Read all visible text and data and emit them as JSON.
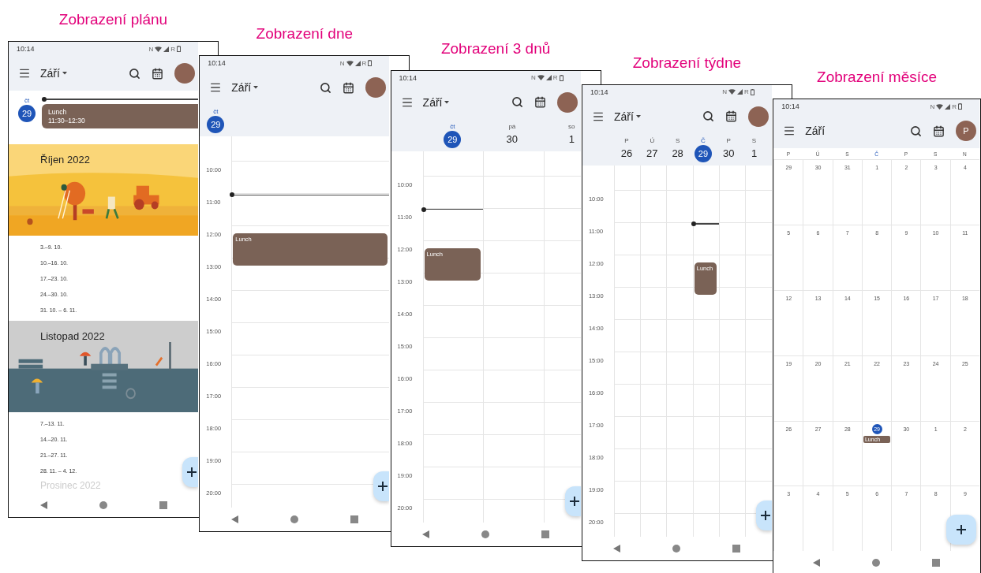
{
  "views": [
    {
      "kind": "schedule",
      "caption": "Zobrazení plánu",
      "status": {
        "time": "10:14",
        "network": "N",
        "roaming": "R"
      },
      "header": {
        "month": "Září",
        "dropdown": true
      },
      "day": {
        "weekday": "čt",
        "date": "29",
        "selected": true,
        "events": [
          {
            "title": "Lunch",
            "time": "11:30–12:30"
          }
        ]
      },
      "sections": [
        {
          "kind": "autumn",
          "title": "Říjen 2022"
        },
        {
          "kind": "week",
          "label": "3.–9. 10."
        },
        {
          "kind": "week",
          "label": "10.–16. 10."
        },
        {
          "kind": "week",
          "label": "17.–23. 10."
        },
        {
          "kind": "week",
          "label": "24.–30. 10."
        },
        {
          "kind": "week",
          "label": "31. 10. – 6. 11."
        },
        {
          "kind": "winter",
          "title": "Listopad 2022"
        },
        {
          "kind": "week",
          "label": "7.–13. 11."
        },
        {
          "kind": "week",
          "label": "14.–20. 11."
        },
        {
          "kind": "week",
          "label": "21.–27. 11."
        },
        {
          "kind": "week",
          "label": "28. 11. – 4. 12."
        },
        {
          "kind": "month",
          "label": "Prosinec 2022"
        }
      ]
    },
    {
      "kind": "day",
      "caption": "Zobrazení dne",
      "status": {
        "time": "10:14",
        "network": "N",
        "roaming": "R"
      },
      "header": {
        "month": "Září",
        "dropdown": true
      },
      "days": [
        {
          "weekday": "čt",
          "date": "29",
          "selected": true,
          "events": [
            {
              "title": "Lunch"
            }
          ]
        }
      ],
      "hours": [
        "10:00",
        "11:00",
        "12:00",
        "13:00",
        "14:00",
        "15:00",
        "16:00",
        "17:00",
        "18:00",
        "19:00",
        "20:00"
      ]
    },
    {
      "kind": "three_day",
      "caption": "Zobrazení 3 dnů",
      "status": {
        "time": "10:14",
        "network": "N",
        "roaming": "R"
      },
      "header": {
        "month": "Září",
        "dropdown": true
      },
      "days": [
        {
          "weekday": "čt",
          "date": "29",
          "selected": true,
          "events": [
            {
              "title": "Lunch"
            }
          ]
        },
        {
          "weekday": "pá",
          "date": "30",
          "selected": false
        },
        {
          "weekday": "so",
          "date": "1",
          "selected": false
        }
      ],
      "hours": [
        "10:00",
        "11:00",
        "12:00",
        "13:00",
        "14:00",
        "15:00",
        "16:00",
        "17:00",
        "18:00",
        "19:00",
        "20:00"
      ]
    },
    {
      "kind": "week",
      "caption": "Zobrazení týdne",
      "status": {
        "time": "10:14",
        "network": "N",
        "roaming": "R"
      },
      "header": {
        "month": "Září",
        "dropdown": true
      },
      "days": [
        {
          "weekday": "P",
          "date": "26",
          "selected": false
        },
        {
          "weekday": "Ú",
          "date": "27",
          "selected": false
        },
        {
          "weekday": "S",
          "date": "28",
          "selected": false
        },
        {
          "weekday": "Č",
          "date": "29",
          "selected": true,
          "events": [
            {
              "title": "Lunch"
            }
          ]
        },
        {
          "weekday": "P",
          "date": "30",
          "selected": false
        },
        {
          "weekday": "S",
          "date": "1",
          "selected": false
        }
      ],
      "hours": [
        "10:00",
        "11:00",
        "12:00",
        "13:00",
        "14:00",
        "15:00",
        "16:00",
        "17:00",
        "18:00",
        "19:00",
        "20:00"
      ]
    },
    {
      "kind": "month",
      "caption": "Zobrazení měsíce",
      "status": {
        "time": "10:14",
        "network": "N",
        "roaming": "R"
      },
      "header": {
        "month": "Září",
        "dropdown": false,
        "avatar": "P"
      },
      "weekdays": [
        {
          "label": "P",
          "selected": false
        },
        {
          "label": "Ú",
          "selected": false
        },
        {
          "label": "S",
          "selected": false
        },
        {
          "label": "Č",
          "selected": true
        },
        {
          "label": "P",
          "selected": false
        },
        {
          "label": "S",
          "selected": false
        },
        {
          "label": "N",
          "selected": false
        }
      ],
      "weeks": [
        [
          {
            "date": "29",
            "selected": false
          },
          {
            "date": "30",
            "selected": false
          },
          {
            "date": "31",
            "selected": false
          },
          {
            "date": "1",
            "selected": false
          },
          {
            "date": "2",
            "selected": false
          },
          {
            "date": "3",
            "selected": false
          },
          {
            "date": "4",
            "selected": false
          }
        ],
        [
          {
            "date": "5",
            "selected": false
          },
          {
            "date": "6",
            "selected": false
          },
          {
            "date": "7",
            "selected": false
          },
          {
            "date": "8",
            "selected": false
          },
          {
            "date": "9",
            "selected": false
          },
          {
            "date": "10",
            "selected": false
          },
          {
            "date": "11",
            "selected": false
          }
        ],
        [
          {
            "date": "12",
            "selected": false
          },
          {
            "date": "13",
            "selected": false
          },
          {
            "date": "14",
            "selected": false
          },
          {
            "date": "15",
            "selected": false
          },
          {
            "date": "16",
            "selected": false
          },
          {
            "date": "17",
            "selected": false
          },
          {
            "date": "18",
            "selected": false
          }
        ],
        [
          {
            "date": "19",
            "selected": false
          },
          {
            "date": "20",
            "selected": false
          },
          {
            "date": "21",
            "selected": false
          },
          {
            "date": "22",
            "selected": false
          },
          {
            "date": "23",
            "selected": false
          },
          {
            "date": "24",
            "selected": false
          },
          {
            "date": "25",
            "selected": false
          }
        ],
        [
          {
            "date": "26",
            "selected": false
          },
          {
            "date": "27",
            "selected": false
          },
          {
            "date": "28",
            "selected": false
          },
          {
            "date": "29",
            "selected": true,
            "events": [
              {
                "title": "Lunch"
              }
            ]
          },
          {
            "date": "30",
            "selected": false
          },
          {
            "date": "1",
            "selected": false
          },
          {
            "date": "2",
            "selected": false
          }
        ],
        [
          {
            "date": "3",
            "selected": false
          },
          {
            "date": "4",
            "selected": false
          },
          {
            "date": "5",
            "selected": false
          },
          {
            "date": "6",
            "selected": false
          },
          {
            "date": "7",
            "selected": false
          },
          {
            "date": "8",
            "selected": false
          },
          {
            "date": "9",
            "selected": false
          }
        ]
      ]
    }
  ]
}
